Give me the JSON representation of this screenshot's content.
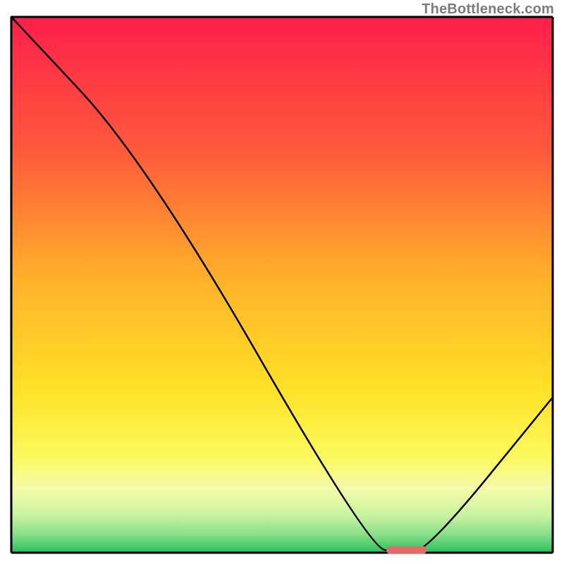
{
  "attribution": "TheBottleneck.com",
  "chart_data": {
    "type": "line",
    "title": "",
    "xlabel": "",
    "ylabel": "",
    "xlim": [
      0,
      100
    ],
    "ylim": [
      0,
      100
    ],
    "grid": false,
    "legend": false,
    "series": [
      {
        "name": "curve",
        "x": [
          0,
          25,
          66,
          72,
          77,
          100
        ],
        "values": [
          100,
          73,
          1,
          0,
          0.5,
          29
        ]
      }
    ],
    "marker_segment": {
      "x0": 70,
      "x1": 76,
      "y": 0.5
    },
    "gradient_stops": [
      {
        "offset": 0.0,
        "color": "#ff1f4b"
      },
      {
        "offset": 0.25,
        "color": "#ff5a3c"
      },
      {
        "offset": 0.5,
        "color": "#ffb429"
      },
      {
        "offset": 0.7,
        "color": "#ffe228"
      },
      {
        "offset": 0.82,
        "color": "#fbf95e"
      },
      {
        "offset": 0.88,
        "color": "#f5fbaa"
      },
      {
        "offset": 0.93,
        "color": "#c9f3a0"
      },
      {
        "offset": 0.965,
        "color": "#8be08a"
      },
      {
        "offset": 1.0,
        "color": "#28c05a"
      }
    ],
    "axis_color": "#000000"
  }
}
